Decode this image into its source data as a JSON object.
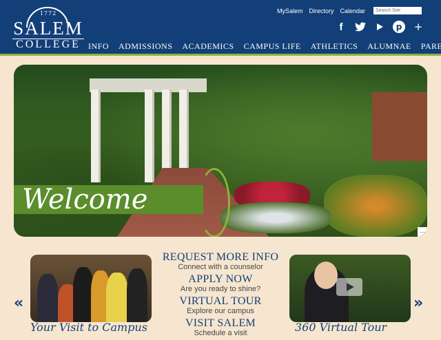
{
  "brand": {
    "year": "1772",
    "name_line1": "SALEM",
    "name_line2": "COLLEGE"
  },
  "utility_nav": [
    "MySalem",
    "Directory",
    "Calendar"
  ],
  "search": {
    "placeholder": "Search Site"
  },
  "social": [
    "facebook-icon",
    "twitter-icon",
    "play-icon",
    "pinterest-icon",
    "plus-icon"
  ],
  "main_nav": [
    "INFO",
    "ADMISSIONS",
    "ACADEMICS",
    "CAMPUS LIFE",
    "ATHLETICS",
    "ALUMNAE",
    "PARENTS"
  ],
  "hero": {
    "welcome": "Welcome",
    "more": "..."
  },
  "cta_links": [
    {
      "title": "REQUEST MORE INFO",
      "subtitle": "Connect with a counselor"
    },
    {
      "title": "APPLY NOW",
      "subtitle": "Are you ready to shine?"
    },
    {
      "title": "VIRTUAL TOUR",
      "subtitle": "Explore our campus"
    },
    {
      "title": "VISIT SALEM",
      "subtitle": "Schedule a visit"
    }
  ],
  "carousel": {
    "prev": "«",
    "next": "»"
  },
  "captions": {
    "left": "Your Visit to Campus",
    "right": "360 Virtual Tour"
  },
  "colors": {
    "header": "#133f78",
    "accent": "#8fb23a",
    "welcome_band": "#5b8d2c"
  }
}
